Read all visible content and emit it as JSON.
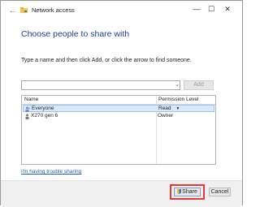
{
  "window": {
    "title": "Network access",
    "controls": {
      "minimize": "—",
      "maximize": "☐",
      "close": "✕"
    },
    "back": "←"
  },
  "dialog": {
    "heading": "Choose people to share with",
    "instruction": "Type a name and then click Add, or click the arrow to find someone.",
    "input": {
      "value": "",
      "dropdown_glyph": "⌄"
    },
    "add_label": "Add",
    "table": {
      "headers": [
        "Name",
        "Permission Level"
      ],
      "rows": [
        {
          "name": "Everyone",
          "permission": "Read",
          "selected": true
        },
        {
          "name": "X270 gen 6",
          "permission": "Owner",
          "selected": false
        }
      ],
      "perm_dropdown_glyph": "▼"
    },
    "help_link": "I'm having trouble sharing",
    "share_label": "Share",
    "cancel_label": "Cancel"
  },
  "colors": {
    "heading": "#1f3f9a",
    "link": "#1a5fb4",
    "selected_row": "#d9e8fb",
    "highlight": "#e53935"
  }
}
